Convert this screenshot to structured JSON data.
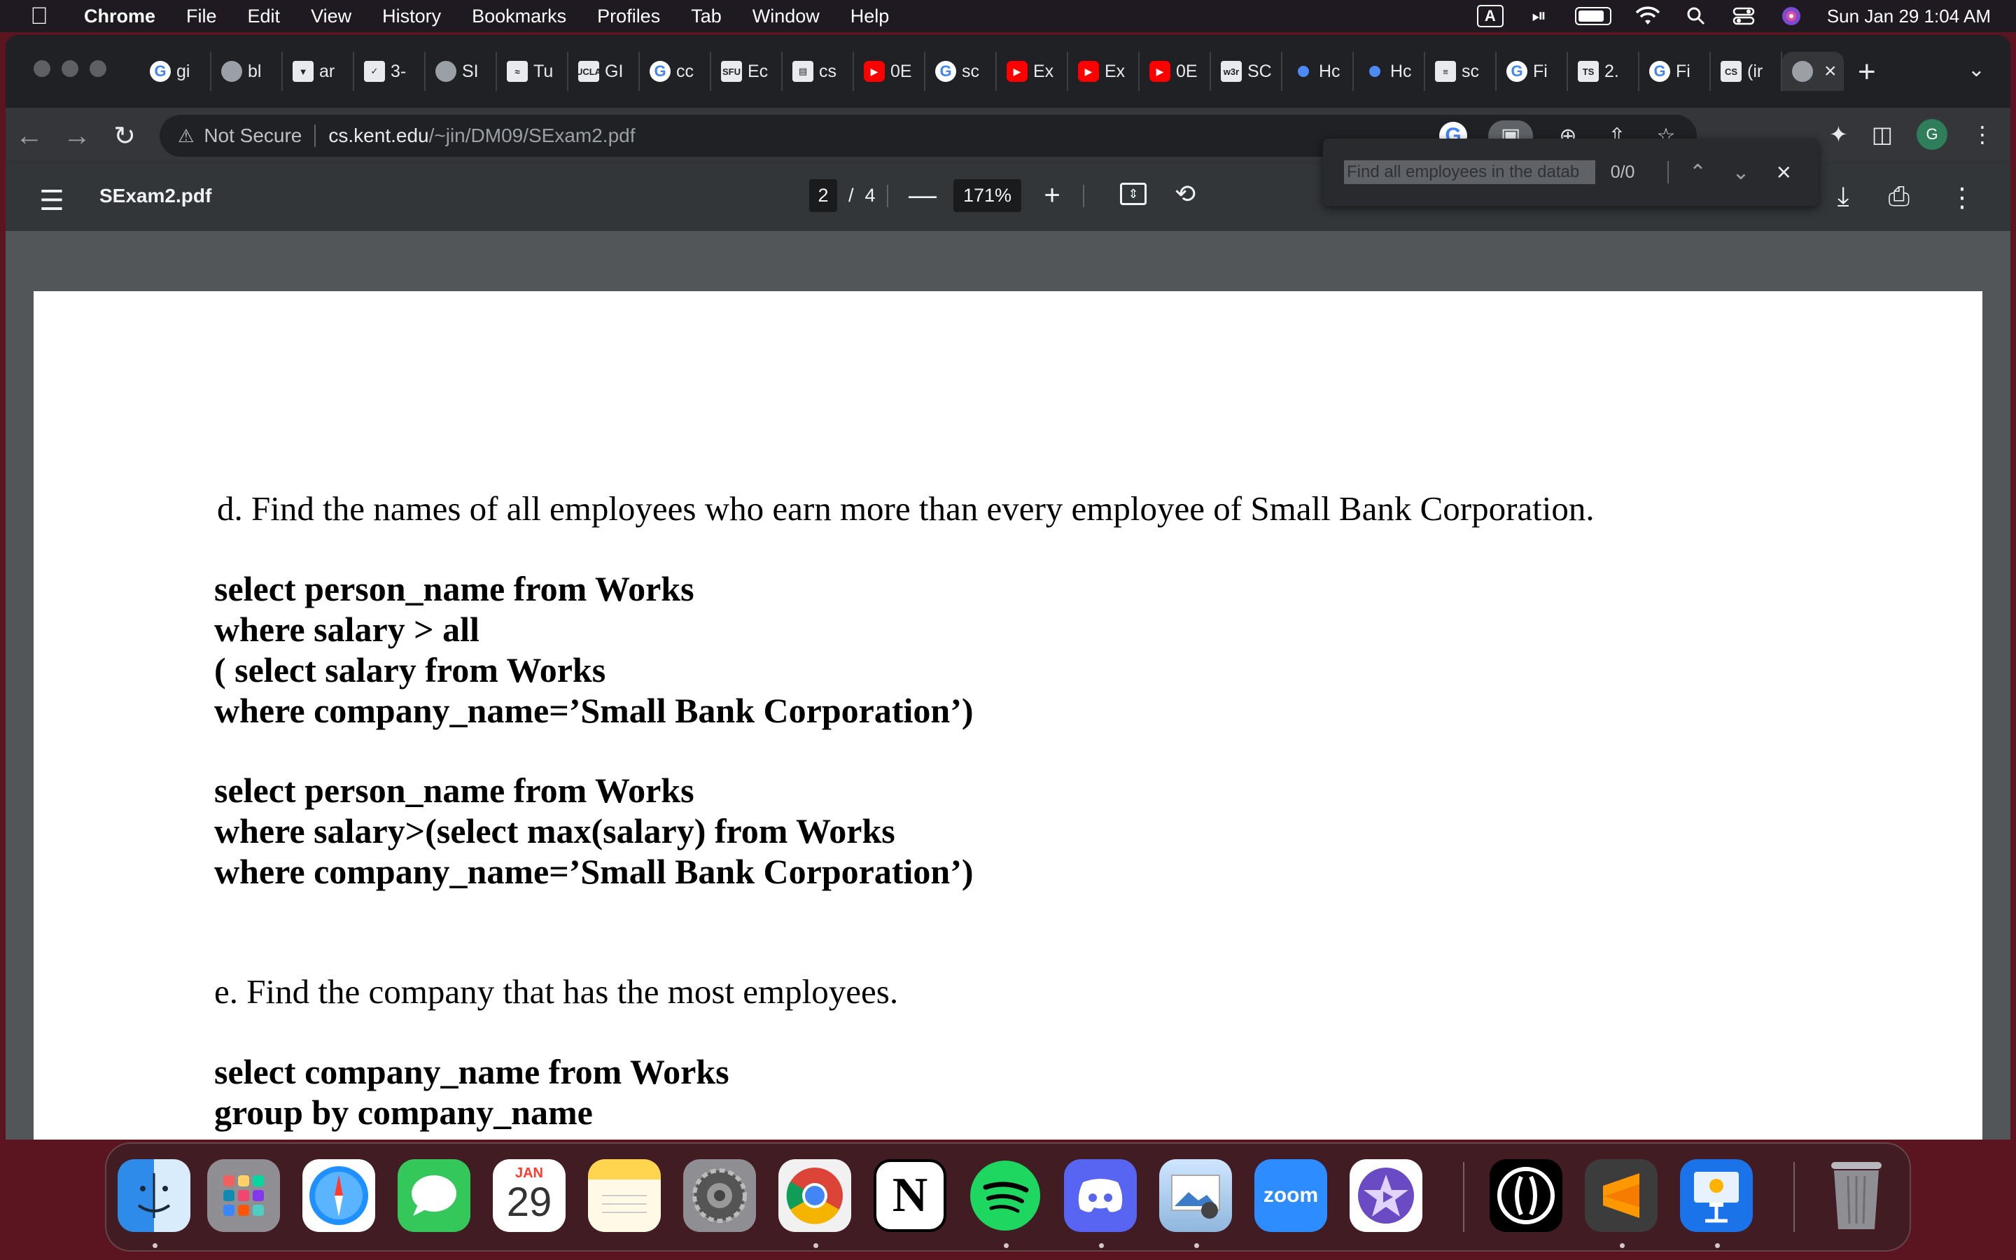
{
  "menubar": {
    "app": "Chrome",
    "items": [
      "File",
      "Edit",
      "View",
      "History",
      "Bookmarks",
      "Profiles",
      "Tab",
      "Window",
      "Help"
    ],
    "keyboard": "A",
    "clock": "Sun Jan 29  1:04 AM"
  },
  "tabs": [
    {
      "glyph": "G",
      "label": "gi",
      "kind": "g"
    },
    {
      "glyph": "",
      "label": "bl",
      "kind": "globe"
    },
    {
      "glyph": "▼",
      "label": "ar",
      "kind": "sq"
    },
    {
      "glyph": "✓",
      "label": "3-",
      "kind": "sq"
    },
    {
      "glyph": "",
      "label": "SI",
      "kind": "globe"
    },
    {
      "glyph": "≈",
      "label": "Tu",
      "kind": "sq"
    },
    {
      "glyph": "UCLA",
      "label": "GI",
      "kind": "sq"
    },
    {
      "glyph": "G",
      "label": "cc",
      "kind": "g"
    },
    {
      "glyph": "SFU",
      "label": "Ec",
      "kind": "sq"
    },
    {
      "glyph": "▤",
      "label": "cs",
      "kind": "sq"
    },
    {
      "glyph": "▶",
      "label": "0E",
      "kind": "yt"
    },
    {
      "glyph": "G",
      "label": "sc",
      "kind": "g"
    },
    {
      "glyph": "▶",
      "label": "Ex",
      "kind": "yt"
    },
    {
      "glyph": "▶",
      "label": "Ex",
      "kind": "yt"
    },
    {
      "glyph": "▶",
      "label": "0E",
      "kind": "yt"
    },
    {
      "glyph": "w3r",
      "label": "SC",
      "kind": "sq"
    },
    {
      "glyph": "",
      "label": "Hc",
      "kind": "dot"
    },
    {
      "glyph": "",
      "label": "Hc",
      "kind": "dot"
    },
    {
      "glyph": "≡",
      "label": "sc",
      "kind": "sq"
    },
    {
      "glyph": "G",
      "label": "Fi",
      "kind": "g"
    },
    {
      "glyph": "TS",
      "label": "2.",
      "kind": "sq"
    },
    {
      "glyph": "G",
      "label": "Fi",
      "kind": "g"
    },
    {
      "glyph": "CS",
      "label": "(ir",
      "kind": "sq"
    }
  ],
  "omnibox": {
    "security": "Not Secure",
    "host": "cs.kent.edu",
    "path": "/~jin/DM09/SExam2.pdf",
    "profile": "G"
  },
  "pdf": {
    "title": "SExam2.pdf",
    "page_current": "2",
    "page_sep": "/",
    "page_total": "4",
    "zoom": "171%"
  },
  "find": {
    "query": "Find all employees in the datab",
    "count": "0/0"
  },
  "document": {
    "q_d": "d. Find the names of all employees who earn more than every employee of Small Bank Corporation.",
    "sql_d1": "select person_name from Works\nwhere salary > all\n( select salary from Works\nwhere company_name=’Small Bank Corporation’)",
    "sql_d2": "select person_name from Works\nwhere salary>(select max(salary) from Works\nwhere company_name=’Small Bank Corporation’)",
    "q_e": "e. Find the company that has the most employees.",
    "sql_e": "select company_name from Works\ngroup by company_name\nhaving count(distinct person_name)>=all"
  },
  "dock": {
    "calendar_month": "JAN",
    "calendar_day": "29",
    "zoom_label": "zoom",
    "notion_label": "N",
    "apps": [
      "finder",
      "launchpad",
      "safari",
      "messages",
      "calendar",
      "notes",
      "system-preferences",
      "chrome",
      "notion",
      "spotify",
      "discord",
      "preview",
      "zoom",
      "imovie",
      "davinci",
      "sublime-text",
      "keynote",
      "trash"
    ]
  }
}
